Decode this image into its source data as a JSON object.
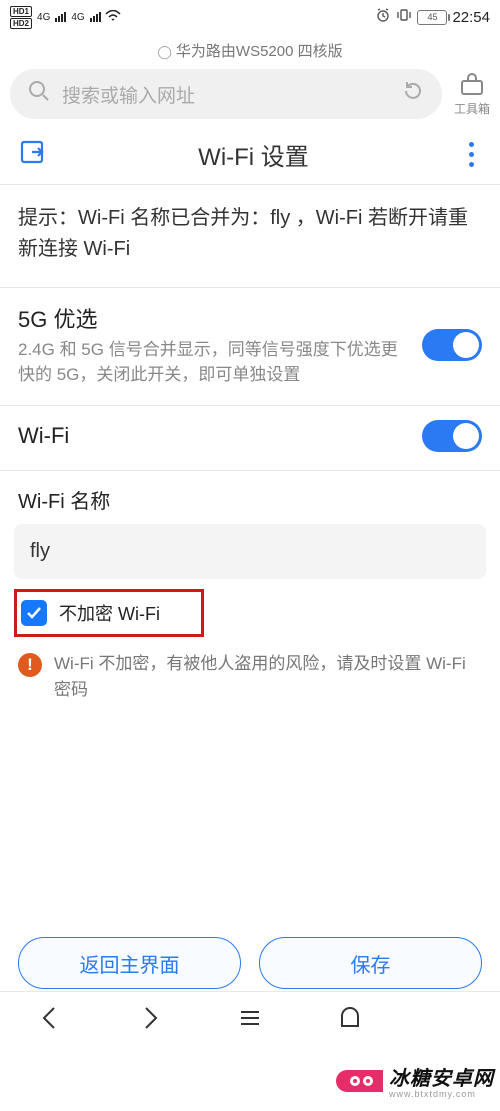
{
  "status": {
    "hd1": "HD1",
    "hd2": "HD2",
    "net": "4G",
    "battery_pct": "45",
    "time": "22:54",
    "alarm_icon": "alarm-icon",
    "vibrate_icon": "vibrate-icon"
  },
  "browser": {
    "tab_title": "华为路由WS5200 四核版",
    "search_placeholder": "搜索或输入网址",
    "toolbox_label": "工具箱"
  },
  "page": {
    "title": "Wi-Fi 设置",
    "hint": "提示：Wi-Fi 名称已合并为：fly ，Wi-Fi 若断开请重新连接 Wi-Fi",
    "pref5g": {
      "title": "5G 优选",
      "sub": "2.4G 和 5G 信号合并显示，同等信号强度下优选更快的 5G，关闭此开关，即可单独设置",
      "on": true
    },
    "wifi": {
      "title": "Wi-Fi",
      "on": true
    },
    "name": {
      "label": "Wi-Fi 名称",
      "value": "fly"
    },
    "no_encrypt": {
      "label": "不加密 Wi-Fi",
      "checked": true
    },
    "warning": "Wi-Fi 不加密，有被他人盗用的风险，请及时设置 Wi-Fi 密码",
    "buttons": {
      "back": "返回主界面",
      "save": "保存"
    }
  },
  "watermark": {
    "brand": "冰糖安卓网",
    "domain": "www.btxtdmy.com"
  }
}
